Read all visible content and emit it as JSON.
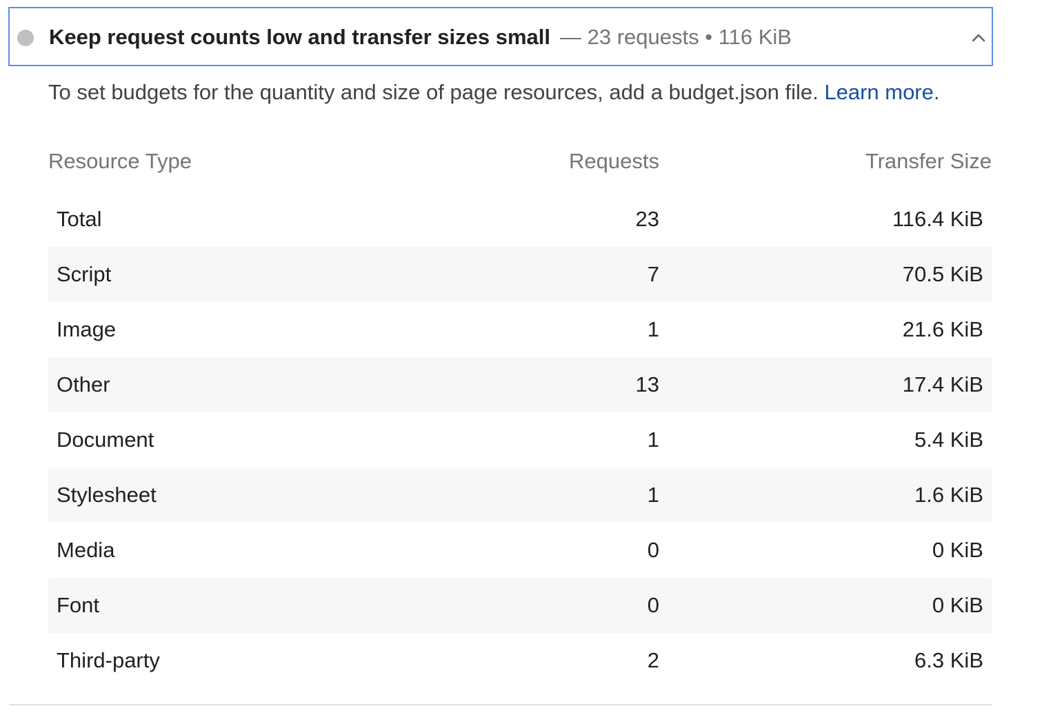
{
  "audit": {
    "title": "Keep request counts low and transfer sizes small",
    "display_value": "— 23 requests • 116 KiB",
    "status_color": "#c0c0c0",
    "border_color": "#5a8ee6",
    "chevron_icon": "chevron-up-icon",
    "description_text": "To set budgets for the quantity and size of page resources, add a budget.json file. ",
    "learn_more": "Learn more",
    "description_end": ".",
    "link_color": "#1a4fa0"
  },
  "table": {
    "headers": {
      "type": "Resource Type",
      "requests": "Requests",
      "size": "Transfer Size"
    },
    "rows": [
      {
        "type": "Total",
        "requests": "23",
        "size": "116.4 KiB"
      },
      {
        "type": "Script",
        "requests": "7",
        "size": "70.5 KiB"
      },
      {
        "type": "Image",
        "requests": "1",
        "size": "21.6 KiB"
      },
      {
        "type": "Other",
        "requests": "13",
        "size": "17.4 KiB"
      },
      {
        "type": "Document",
        "requests": "1",
        "size": "5.4 KiB"
      },
      {
        "type": "Stylesheet",
        "requests": "1",
        "size": "1.6 KiB"
      },
      {
        "type": "Media",
        "requests": "0",
        "size": "0 KiB"
      },
      {
        "type": "Font",
        "requests": "0",
        "size": "0 KiB"
      },
      {
        "type": "Third-party",
        "requests": "2",
        "size": "6.3 KiB"
      }
    ]
  }
}
